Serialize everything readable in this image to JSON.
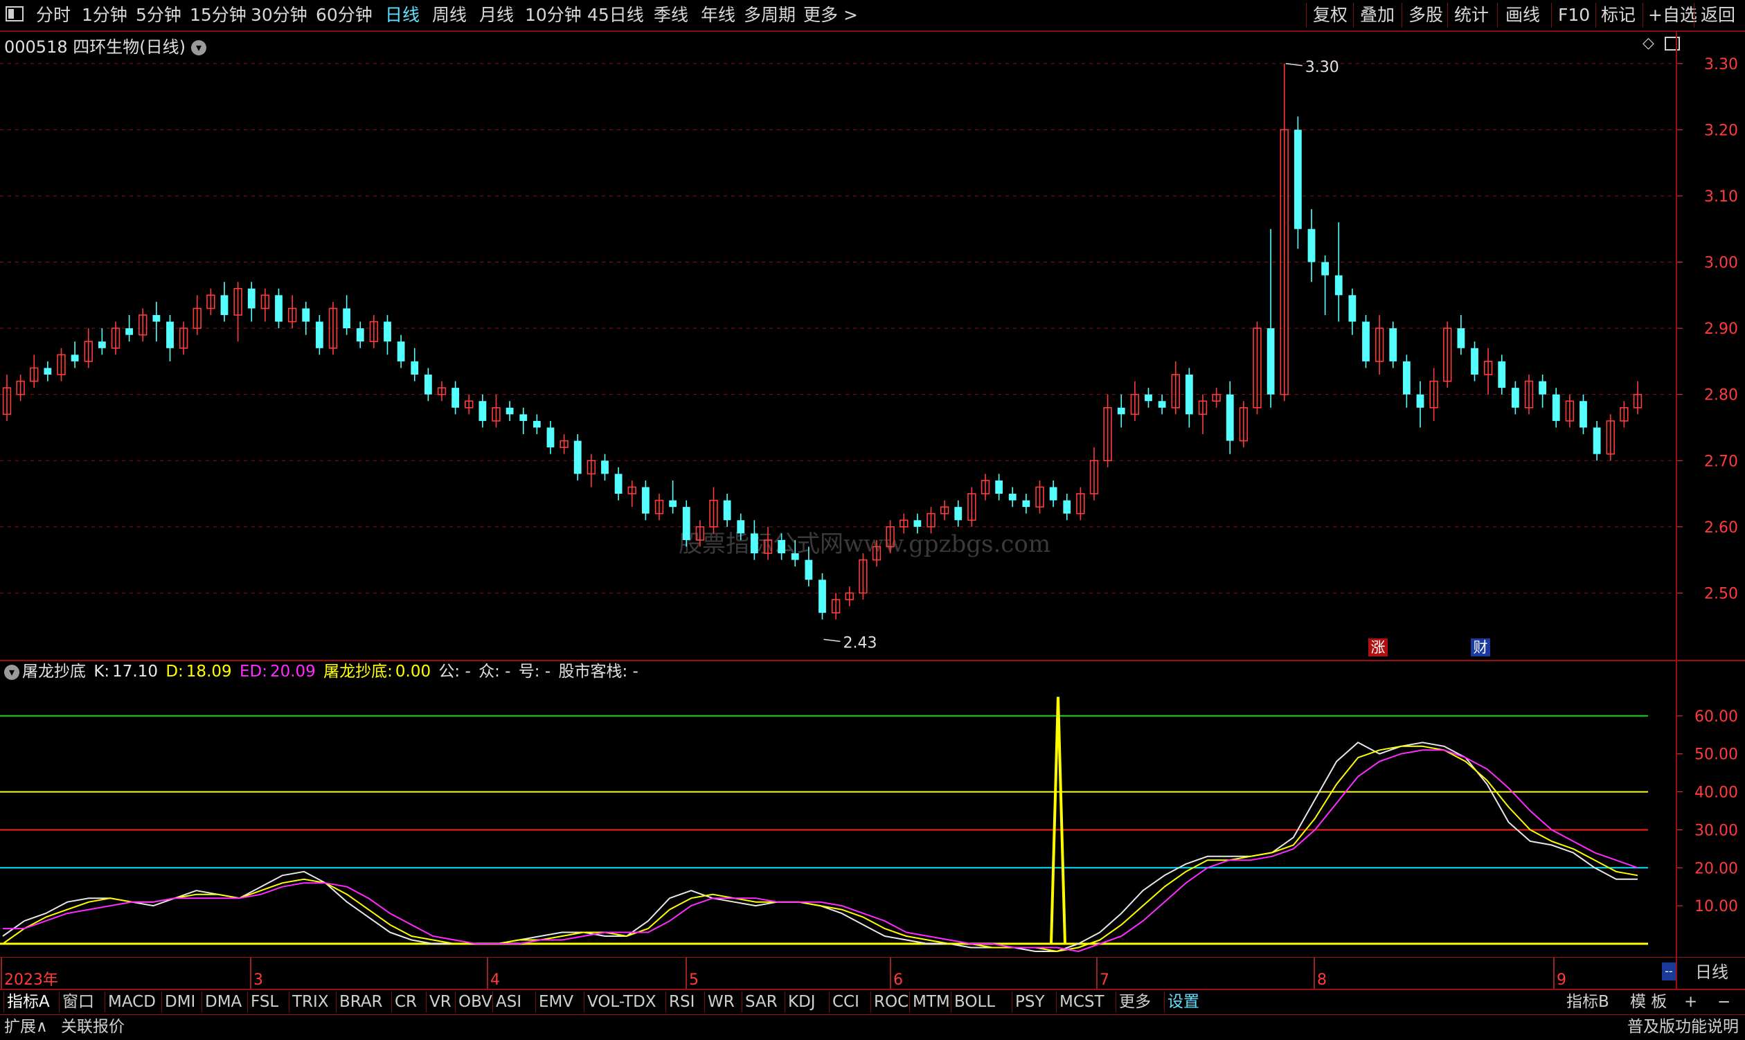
{
  "toolbar": {
    "left_items": [
      "分时",
      "1分钟",
      "5分钟",
      "15分钟",
      "30分钟",
      "60分钟",
      "日线",
      "周线",
      "月线",
      "10分钟",
      "45日线",
      "季线",
      "年线",
      "多周期",
      "更多 >"
    ],
    "active": "日线",
    "right_items": [
      "复权",
      "叠加",
      "多股",
      "统计",
      "画线",
      "F10",
      "标记",
      "+自选",
      "返回"
    ]
  },
  "stock": {
    "code": "000518",
    "name": "四环生物",
    "period": "(日线)"
  },
  "watermark": "股票指标公式网www.gpzbgs.com",
  "indicator_legend": {
    "name": "屠龙抄底",
    "k_label": "K:",
    "k_value": "17.10",
    "d_label": "D:",
    "d_value": "18.09",
    "ed_label": "ED:",
    "ed_value": "20.09",
    "tl_label": "屠龙抄底:",
    "tl_value": "0.00",
    "gong": "公: -",
    "zhong": "众: -",
    "hao": "号: -",
    "kezhan": "股市客栈: -"
  },
  "badges": {
    "zhang": "涨",
    "cai": "财"
  },
  "date_axis": {
    "labels": [
      "2023年",
      "3",
      "4",
      "5",
      "6",
      "7",
      "8",
      "9"
    ],
    "period": "日线",
    "corner": "--"
  },
  "indicator_tabs": [
    "指标A",
    "窗口",
    "MACD",
    "DMI",
    "DMA",
    "FSL",
    "TRIX",
    "BRAR",
    "CR",
    "VR",
    "OBV",
    "ASI",
    "EMV",
    "VOL-TDX",
    "RSI",
    "WR",
    "SAR",
    "KDJ",
    "CCI",
    "ROC",
    "MTM",
    "BOLL",
    "PSY",
    "MCST",
    "更多",
    "设置"
  ],
  "tabs_right": [
    "指标B",
    "模 板",
    "+",
    "−"
  ],
  "bottom_bar": {
    "left1": "扩展∧",
    "left2": "关联报价",
    "right": "普及版功能说明"
  },
  "colors": {
    "up": "#ff3b3b",
    "down": "#54ffff",
    "k": "#e8e8e8",
    "d": "#ffff00",
    "ed": "#ff2bff",
    "tl": "#ffff00",
    "grid": "#8a1010",
    "axis_text": "#ff3b3b"
  },
  "chart_data": [
    {
      "type": "candlestick",
      "title": "000518 四环生物(日线)",
      "ylim": [
        2.4,
        3.35
      ],
      "y_ticks": [
        2.5,
        2.6,
        2.7,
        2.8,
        2.9,
        3.0,
        3.1,
        3.2,
        3.3
      ],
      "annotations": [
        {
          "label": "3.30",
          "value": 3.3
        },
        {
          "label": "2.43",
          "value": 2.43
        }
      ],
      "candles": [
        [
          2.77,
          2.81,
          2.83,
          2.76
        ],
        [
          2.8,
          2.82,
          2.83,
          2.79
        ],
        [
          2.82,
          2.84,
          2.86,
          2.81
        ],
        [
          2.84,
          2.83,
          2.85,
          2.82
        ],
        [
          2.83,
          2.86,
          2.87,
          2.82
        ],
        [
          2.86,
          2.85,
          2.88,
          2.84
        ],
        [
          2.85,
          2.88,
          2.9,
          2.84
        ],
        [
          2.88,
          2.87,
          2.9,
          2.86
        ],
        [
          2.87,
          2.9,
          2.91,
          2.86
        ],
        [
          2.9,
          2.89,
          2.92,
          2.88
        ],
        [
          2.89,
          2.92,
          2.93,
          2.88
        ],
        [
          2.92,
          2.91,
          2.94,
          2.88
        ],
        [
          2.91,
          2.87,
          2.92,
          2.85
        ],
        [
          2.87,
          2.9,
          2.91,
          2.86
        ],
        [
          2.9,
          2.93,
          2.95,
          2.89
        ],
        [
          2.93,
          2.95,
          2.96,
          2.92
        ],
        [
          2.95,
          2.92,
          2.97,
          2.91
        ],
        [
          2.92,
          2.96,
          2.97,
          2.88
        ],
        [
          2.96,
          2.93,
          2.97,
          2.91
        ],
        [
          2.93,
          2.95,
          2.96,
          2.91
        ],
        [
          2.95,
          2.91,
          2.96,
          2.9
        ],
        [
          2.91,
          2.93,
          2.95,
          2.9
        ],
        [
          2.93,
          2.91,
          2.94,
          2.89
        ],
        [
          2.91,
          2.87,
          2.92,
          2.86
        ],
        [
          2.87,
          2.93,
          2.94,
          2.86
        ],
        [
          2.93,
          2.9,
          2.95,
          2.89
        ],
        [
          2.9,
          2.88,
          2.91,
          2.87
        ],
        [
          2.88,
          2.91,
          2.92,
          2.87
        ],
        [
          2.91,
          2.88,
          2.92,
          2.86
        ],
        [
          2.88,
          2.85,
          2.89,
          2.84
        ],
        [
          2.85,
          2.83,
          2.87,
          2.82
        ],
        [
          2.83,
          2.8,
          2.84,
          2.79
        ],
        [
          2.8,
          2.81,
          2.82,
          2.79
        ],
        [
          2.81,
          2.78,
          2.82,
          2.77
        ],
        [
          2.78,
          2.79,
          2.8,
          2.77
        ],
        [
          2.79,
          2.76,
          2.8,
          2.75
        ],
        [
          2.76,
          2.78,
          2.8,
          2.75
        ],
        [
          2.78,
          2.77,
          2.79,
          2.76
        ],
        [
          2.77,
          2.76,
          2.78,
          2.74
        ],
        [
          2.76,
          2.75,
          2.77,
          2.74
        ],
        [
          2.75,
          2.72,
          2.76,
          2.71
        ],
        [
          2.72,
          2.73,
          2.74,
          2.71
        ],
        [
          2.73,
          2.68,
          2.74,
          2.67
        ],
        [
          2.68,
          2.7,
          2.71,
          2.66
        ],
        [
          2.7,
          2.68,
          2.71,
          2.67
        ],
        [
          2.68,
          2.65,
          2.69,
          2.64
        ],
        [
          2.65,
          2.66,
          2.67,
          2.63
        ],
        [
          2.66,
          2.62,
          2.67,
          2.61
        ],
        [
          2.62,
          2.64,
          2.65,
          2.61
        ],
        [
          2.64,
          2.63,
          2.67,
          2.62
        ],
        [
          2.63,
          2.58,
          2.64,
          2.57
        ],
        [
          2.58,
          2.6,
          2.61,
          2.57
        ],
        [
          2.6,
          2.64,
          2.66,
          2.59
        ],
        [
          2.64,
          2.61,
          2.65,
          2.6
        ],
        [
          2.61,
          2.59,
          2.62,
          2.58
        ],
        [
          2.59,
          2.56,
          2.61,
          2.55
        ],
        [
          2.56,
          2.58,
          2.6,
          2.55
        ],
        [
          2.58,
          2.56,
          2.59,
          2.55
        ],
        [
          2.56,
          2.55,
          2.58,
          2.54
        ],
        [
          2.55,
          2.52,
          2.57,
          2.51
        ],
        [
          2.52,
          2.47,
          2.53,
          2.46
        ],
        [
          2.47,
          2.49,
          2.5,
          2.46
        ],
        [
          2.49,
          2.5,
          2.51,
          2.48
        ],
        [
          2.5,
          2.55,
          2.56,
          2.49
        ],
        [
          2.55,
          2.57,
          2.58,
          2.54
        ],
        [
          2.57,
          2.6,
          2.61,
          2.56
        ],
        [
          2.6,
          2.61,
          2.62,
          2.59
        ],
        [
          2.61,
          2.6,
          2.62,
          2.59
        ],
        [
          2.6,
          2.62,
          2.63,
          2.59
        ],
        [
          2.62,
          2.63,
          2.64,
          2.61
        ],
        [
          2.63,
          2.61,
          2.64,
          2.6
        ],
        [
          2.61,
          2.65,
          2.66,
          2.6
        ],
        [
          2.65,
          2.67,
          2.68,
          2.64
        ],
        [
          2.67,
          2.65,
          2.68,
          2.64
        ],
        [
          2.65,
          2.64,
          2.66,
          2.63
        ],
        [
          2.64,
          2.63,
          2.65,
          2.62
        ],
        [
          2.63,
          2.66,
          2.67,
          2.62
        ],
        [
          2.66,
          2.64,
          2.67,
          2.63
        ],
        [
          2.64,
          2.62,
          2.65,
          2.61
        ],
        [
          2.62,
          2.65,
          2.66,
          2.61
        ],
        [
          2.65,
          2.7,
          2.72,
          2.64
        ],
        [
          2.7,
          2.78,
          2.8,
          2.69
        ],
        [
          2.78,
          2.77,
          2.8,
          2.75
        ],
        [
          2.77,
          2.8,
          2.82,
          2.76
        ],
        [
          2.8,
          2.79,
          2.81,
          2.78
        ],
        [
          2.79,
          2.78,
          2.8,
          2.77
        ],
        [
          2.78,
          2.83,
          2.85,
          2.77
        ],
        [
          2.83,
          2.77,
          2.84,
          2.75
        ],
        [
          2.77,
          2.79,
          2.8,
          2.74
        ],
        [
          2.79,
          2.8,
          2.81,
          2.78
        ],
        [
          2.8,
          2.73,
          2.82,
          2.71
        ],
        [
          2.73,
          2.78,
          2.79,
          2.72
        ],
        [
          2.78,
          2.9,
          2.91,
          2.77
        ],
        [
          2.9,
          2.8,
          3.05,
          2.78
        ],
        [
          2.8,
          3.2,
          3.3,
          2.79
        ],
        [
          3.2,
          3.05,
          3.22,
          3.02
        ],
        [
          3.05,
          3.0,
          3.08,
          2.97
        ],
        [
          3.0,
          2.98,
          3.01,
          2.92
        ],
        [
          2.98,
          2.95,
          3.06,
          2.91
        ],
        [
          2.95,
          2.91,
          2.96,
          2.89
        ],
        [
          2.91,
          2.85,
          2.92,
          2.84
        ],
        [
          2.85,
          2.9,
          2.92,
          2.83
        ],
        [
          2.9,
          2.85,
          2.91,
          2.84
        ],
        [
          2.85,
          2.8,
          2.86,
          2.78
        ],
        [
          2.8,
          2.78,
          2.82,
          2.75
        ],
        [
          2.78,
          2.82,
          2.84,
          2.76
        ],
        [
          2.82,
          2.9,
          2.91,
          2.81
        ],
        [
          2.9,
          2.87,
          2.92,
          2.86
        ],
        [
          2.87,
          2.83,
          2.88,
          2.82
        ],
        [
          2.83,
          2.85,
          2.87,
          2.8
        ],
        [
          2.85,
          2.81,
          2.86,
          2.8
        ],
        [
          2.81,
          2.78,
          2.82,
          2.77
        ],
        [
          2.78,
          2.82,
          2.83,
          2.77
        ],
        [
          2.82,
          2.8,
          2.83,
          2.78
        ],
        [
          2.8,
          2.76,
          2.81,
          2.75
        ],
        [
          2.76,
          2.79,
          2.8,
          2.75
        ],
        [
          2.79,
          2.75,
          2.8,
          2.74
        ],
        [
          2.75,
          2.71,
          2.76,
          2.7
        ],
        [
          2.71,
          2.76,
          2.77,
          2.7
        ],
        [
          2.76,
          2.78,
          2.79,
          2.75
        ],
        [
          2.78,
          2.8,
          2.82,
          2.77
        ]
      ]
    },
    {
      "type": "line",
      "title": "屠龙抄底",
      "ylim": [
        0,
        68
      ],
      "y_ticks": [
        10.0,
        20.0,
        30.0,
        40.0,
        50.0,
        60.0
      ],
      "hlines": [
        {
          "value": 60,
          "color": "#00dd00"
        },
        {
          "value": 40,
          "color": "#ffff00"
        },
        {
          "value": 30,
          "color": "#ff2020"
        },
        {
          "value": 20,
          "color": "#00e5ff"
        },
        {
          "value": 0,
          "color": "#ffff00"
        }
      ],
      "series": [
        {
          "name": "K",
          "color": "#e8e8e8",
          "values": [
            2,
            6,
            8,
            11,
            12,
            12,
            11,
            10,
            12,
            14,
            13,
            12,
            15,
            18,
            19,
            16,
            11,
            7,
            3,
            1,
            0,
            0,
            0,
            0,
            1,
            2,
            3,
            3,
            2,
            2,
            6,
            12,
            14,
            12,
            11,
            10,
            11,
            11,
            10,
            8,
            5,
            2,
            1,
            0,
            0,
            -1,
            -1,
            -1,
            -2,
            -2,
            0,
            3,
            8,
            14,
            18,
            21,
            23,
            23,
            23,
            24,
            28,
            38,
            48,
            53,
            50,
            52,
            53,
            52,
            49,
            42,
            32,
            27,
            26,
            24,
            20,
            17,
            17
          ]
        },
        {
          "name": "D",
          "color": "#ffff00",
          "values": [
            0,
            4,
            7,
            9,
            11,
            12,
            11,
            11,
            12,
            13,
            13,
            12,
            14,
            16,
            17,
            16,
            13,
            9,
            5,
            2,
            1,
            0,
            0,
            0,
            1,
            1,
            2,
            3,
            3,
            2,
            4,
            9,
            12,
            13,
            12,
            11,
            11,
            11,
            10,
            9,
            7,
            4,
            2,
            1,
            0,
            0,
            -1,
            -1,
            -1,
            -2,
            -1,
            1,
            5,
            10,
            15,
            19,
            22,
            22,
            23,
            24,
            26,
            33,
            42,
            49,
            51,
            52,
            52,
            51,
            48,
            43,
            36,
            30,
            27,
            25,
            22,
            19,
            18
          ]
        },
        {
          "name": "ED",
          "color": "#ff2bff",
          "values": [
            4,
            4,
            6,
            8,
            9,
            10,
            11,
            11,
            12,
            12,
            12,
            12,
            13,
            15,
            16,
            16,
            15,
            12,
            8,
            5,
            2,
            1,
            0,
            0,
            0,
            1,
            1,
            2,
            3,
            3,
            3,
            6,
            10,
            12,
            12,
            12,
            11,
            11,
            11,
            10,
            8,
            6,
            3,
            2,
            1,
            0,
            0,
            -1,
            -1,
            -1,
            -2,
            0,
            2,
            6,
            11,
            16,
            20,
            22,
            22,
            23,
            25,
            30,
            37,
            44,
            48,
            50,
            51,
            51,
            49,
            46,
            41,
            35,
            30,
            27,
            24,
            22,
            20
          ]
        },
        {
          "name": "屠龙抄底",
          "color": "#ffff00",
          "values": [
            0,
            0,
            0,
            0,
            0,
            0,
            0,
            0,
            0,
            0,
            0,
            0,
            0,
            0,
            0,
            0,
            0,
            0,
            0,
            0,
            0,
            0,
            0,
            0,
            0,
            0,
            0,
            0,
            0,
            0,
            0,
            0,
            0,
            0,
            0,
            0,
            0,
            0,
            0,
            0,
            0,
            0,
            0,
            0,
            0,
            0,
            0,
            0,
            0,
            0,
            0,
            0,
            0,
            0,
            0,
            0,
            0,
            0,
            0,
            0,
            0,
            0,
            0,
            0,
            0,
            0,
            0,
            0,
            0,
            0,
            0,
            0,
            0,
            0,
            0,
            0,
            0
          ]
        }
      ],
      "spike": {
        "value": 65
      }
    }
  ]
}
